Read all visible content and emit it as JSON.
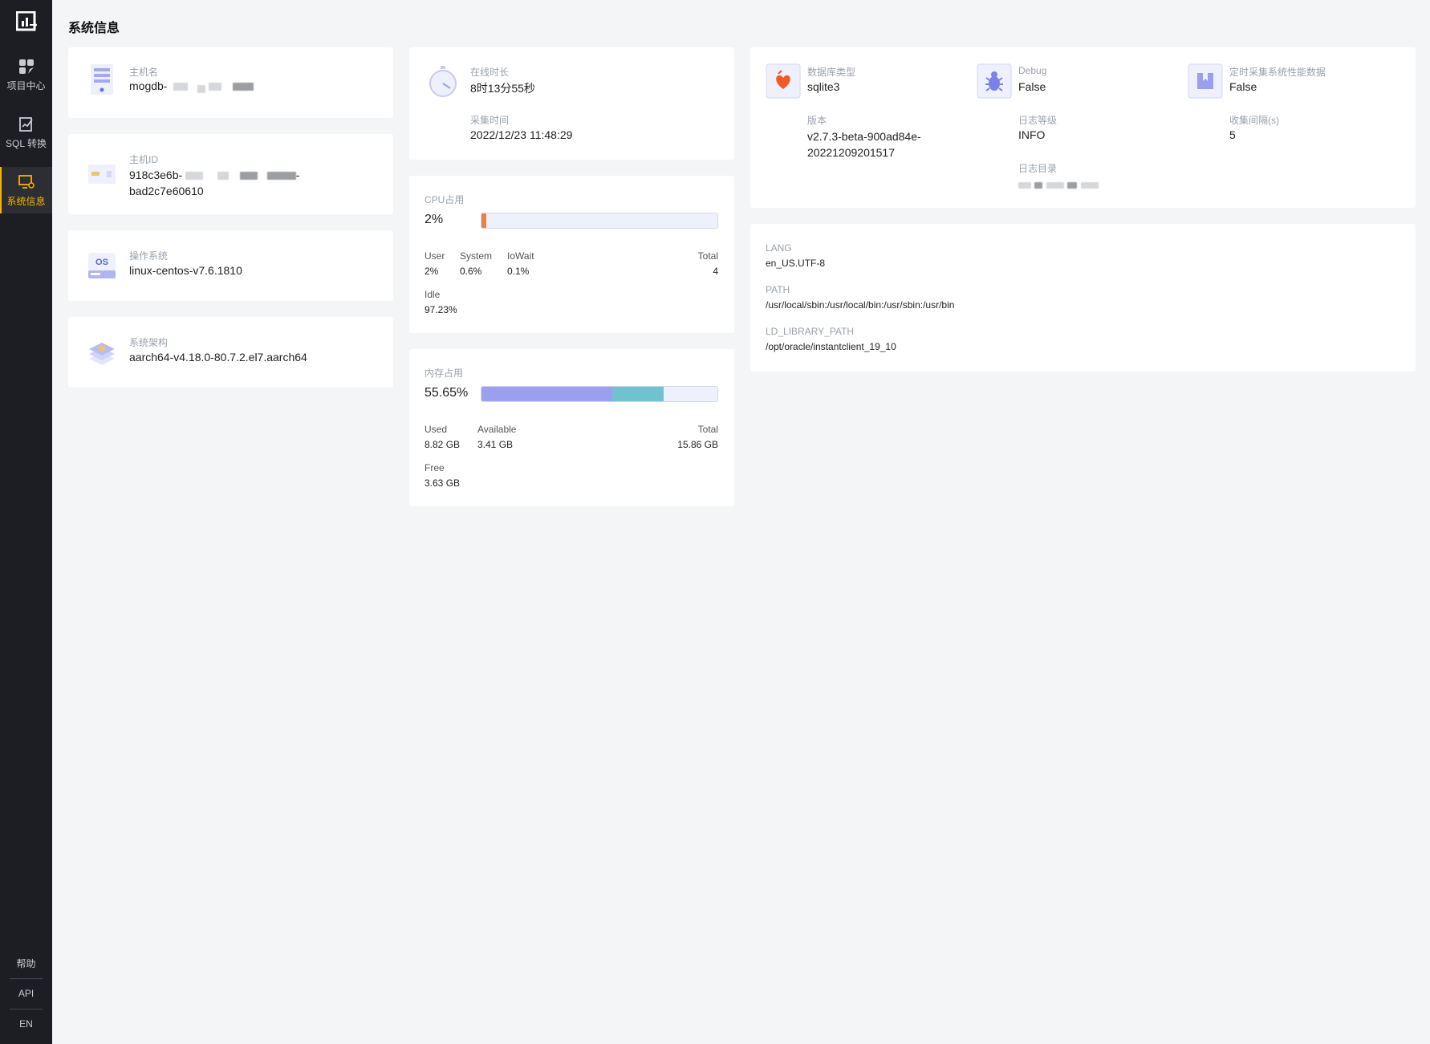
{
  "sidebar": {
    "nav": [
      {
        "label": "项目中心",
        "icon": "dashboard-icon"
      },
      {
        "label": "SQL 转换",
        "icon": "sql-convert-icon"
      },
      {
        "label": "系统信息",
        "icon": "system-info-icon"
      }
    ],
    "bottom": [
      {
        "label": "帮助"
      },
      {
        "label": "API"
      },
      {
        "label": "EN"
      }
    ],
    "colors": {
      "background": "#1d1e23",
      "active": "#f4b400"
    }
  },
  "page": {
    "title": "系统信息"
  },
  "host": {
    "hostname": {
      "label": "主机名",
      "value": "mogdb-",
      "icon": "server-icon"
    },
    "host_id": {
      "label": "主机ID",
      "value_line1": "918c3e6b-",
      "value_line1_tail": "-",
      "value_line2": "bad2c7e60610",
      "icon": "id-card-icon"
    },
    "os": {
      "label": "操作系统",
      "value": "linux-centos-v7.6.1810",
      "icon": "os-disk-icon",
      "icon_text": "OS"
    },
    "arch": {
      "label": "系统架构",
      "value": "aarch64-v4.18.0-80.7.2.el7.aarch64",
      "icon": "layers-icon"
    }
  },
  "uptime": {
    "uptime_label": "在线时长",
    "uptime_value": "8时13分55秒",
    "collect_label": "采集时间",
    "collect_value": "2022/12/23 11:48:29",
    "icon": "stopwatch-icon"
  },
  "cpu": {
    "label": "CPU占用",
    "percent_text": "2%",
    "percent": 2,
    "user_label": "User",
    "user_value": "2%",
    "system_label": "System",
    "system_value": "0.6%",
    "iowait_label": "IoWait",
    "iowait_value": "0.1%",
    "total_label": "Total",
    "total_value": "4",
    "idle_label": "Idle",
    "idle_value": "97.23%",
    "color": "#e0844a"
  },
  "memory": {
    "label": "内存占用",
    "percent_text": "55.65%",
    "used_fraction": 0.556,
    "available_fraction": 0.215,
    "used_label": "Used",
    "used_value": "8.82 GB",
    "available_label": "Available",
    "available_value": "3.41 GB",
    "total_label": "Total",
    "total_value": "15.86 GB",
    "free_label": "Free",
    "free_value": "3.63 GB",
    "used_color": "#9aa0ee",
    "available_color": "#6ec3cf"
  },
  "app": {
    "db_type": {
      "label": "数据库类型",
      "value": "sqlite3",
      "icon": "database-heart-icon"
    },
    "debug": {
      "label": "Debug",
      "value": "False",
      "icon": "bug-icon"
    },
    "perf": {
      "label": "定时采集系统性能数据",
      "value": "False",
      "icon": "bookmark-icon"
    },
    "version": {
      "label": "版本",
      "value_line1": "v2.7.3-beta-900ad84e-",
      "value_line2": "20221209201517"
    },
    "log_level": {
      "label": "日志等级",
      "value": "INFO"
    },
    "interval": {
      "label": "收集间隔(s)",
      "value": "5"
    },
    "log_dir": {
      "label": "日志目录"
    }
  },
  "env": {
    "lang": {
      "label": "LANG",
      "value": "en_US.UTF-8"
    },
    "path": {
      "label": "PATH",
      "value": "/usr/local/sbin:/usr/local/bin:/usr/sbin:/usr/bin"
    },
    "ld": {
      "label": "LD_LIBRARY_PATH",
      "value": "/opt/oracle/instantclient_19_10"
    }
  }
}
